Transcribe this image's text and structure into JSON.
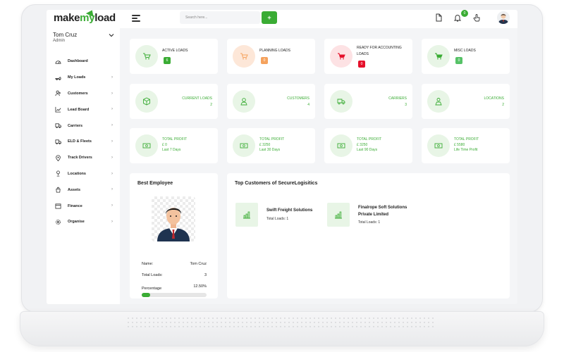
{
  "brand": {
    "logo_prefix": "make",
    "logo_my": "my",
    "logo_suffix": "load",
    "accent": "#3aac34"
  },
  "search": {
    "placeholder": "Search here...",
    "button_label": "+"
  },
  "header": {
    "notification_count": "0"
  },
  "user": {
    "name": "Tom Cruz",
    "role": "Admin"
  },
  "sidebar": {
    "items": [
      {
        "label": "Dashboard",
        "icon": "speedometer-icon",
        "has_arrow": false
      },
      {
        "label": "My Loads",
        "icon": "truck-icon",
        "has_arrow": true
      },
      {
        "label": "Customers",
        "icon": "user-plus-icon",
        "has_arrow": true
      },
      {
        "label": "Lead Board",
        "icon": "chart-line-icon",
        "has_arrow": true
      },
      {
        "label": "Carriers",
        "icon": "truck-icon",
        "has_arrow": true
      },
      {
        "label": "ELD & Fleets",
        "icon": "truck-icon",
        "has_arrow": true
      },
      {
        "label": "Track Drivers",
        "icon": "map-pin-icon",
        "has_arrow": true
      },
      {
        "label": "Locations",
        "icon": "location-icon",
        "has_arrow": true
      },
      {
        "label": "Assets",
        "icon": "bag-icon",
        "has_arrow": true
      },
      {
        "label": "Finance",
        "icon": "calendar-icon",
        "has_arrow": true
      },
      {
        "label": "Organise",
        "icon": "gear-icon",
        "has_arrow": true
      }
    ]
  },
  "loads": [
    {
      "label": "ACTIVE LOADS",
      "count": "6",
      "color": "#3aac34"
    },
    {
      "label": "PLANNING LOADS",
      "count": "0",
      "color": "#f5a25d"
    },
    {
      "label": "READY FOR ACCOUNTING LOADS",
      "count": "0",
      "color": "#e5112b"
    },
    {
      "label": "MISC LOADS",
      "count": "0",
      "color": "#56c267"
    }
  ],
  "summary": [
    {
      "label": "CURRENT LOADS",
      "value": "2"
    },
    {
      "label": "CUSTOMERS",
      "value": "4"
    },
    {
      "label": "CARRIERS",
      "value": "3"
    },
    {
      "label": "LOCATIONS",
      "value": "2"
    }
  ],
  "profits": [
    {
      "label": "TOTAL PROFIT",
      "amount": "£ 0",
      "period": "Last 7 Days"
    },
    {
      "label": "TOTAL PROFIT",
      "amount": "£ 3250",
      "period": "Last 30 Days"
    },
    {
      "label": "TOTAL PROFIT",
      "amount": "£ 3250",
      "period": "Last 90 Days"
    },
    {
      "label": "TOTAL PROFIT",
      "amount": "£ 5580",
      "period": "Life Time Profit"
    }
  ],
  "best_employee": {
    "title": "Best Employee",
    "name_label": "Name:",
    "name": "Tom Cruz",
    "loads_label": "Total Loads:",
    "loads": "3",
    "percentage_label": "Percentage",
    "percentage": "12.50%",
    "progress": 0.125
  },
  "top_customers": {
    "title": "Top Customers of SecureLogisitics",
    "items": [
      {
        "name": "Swift Freight Solutions",
        "loads": "Total Loads: 1"
      },
      {
        "name_line1": "Finalrope Soft Solutions",
        "name_line2": "Private Limited",
        "loads": "Total Loads: 1"
      }
    ]
  }
}
